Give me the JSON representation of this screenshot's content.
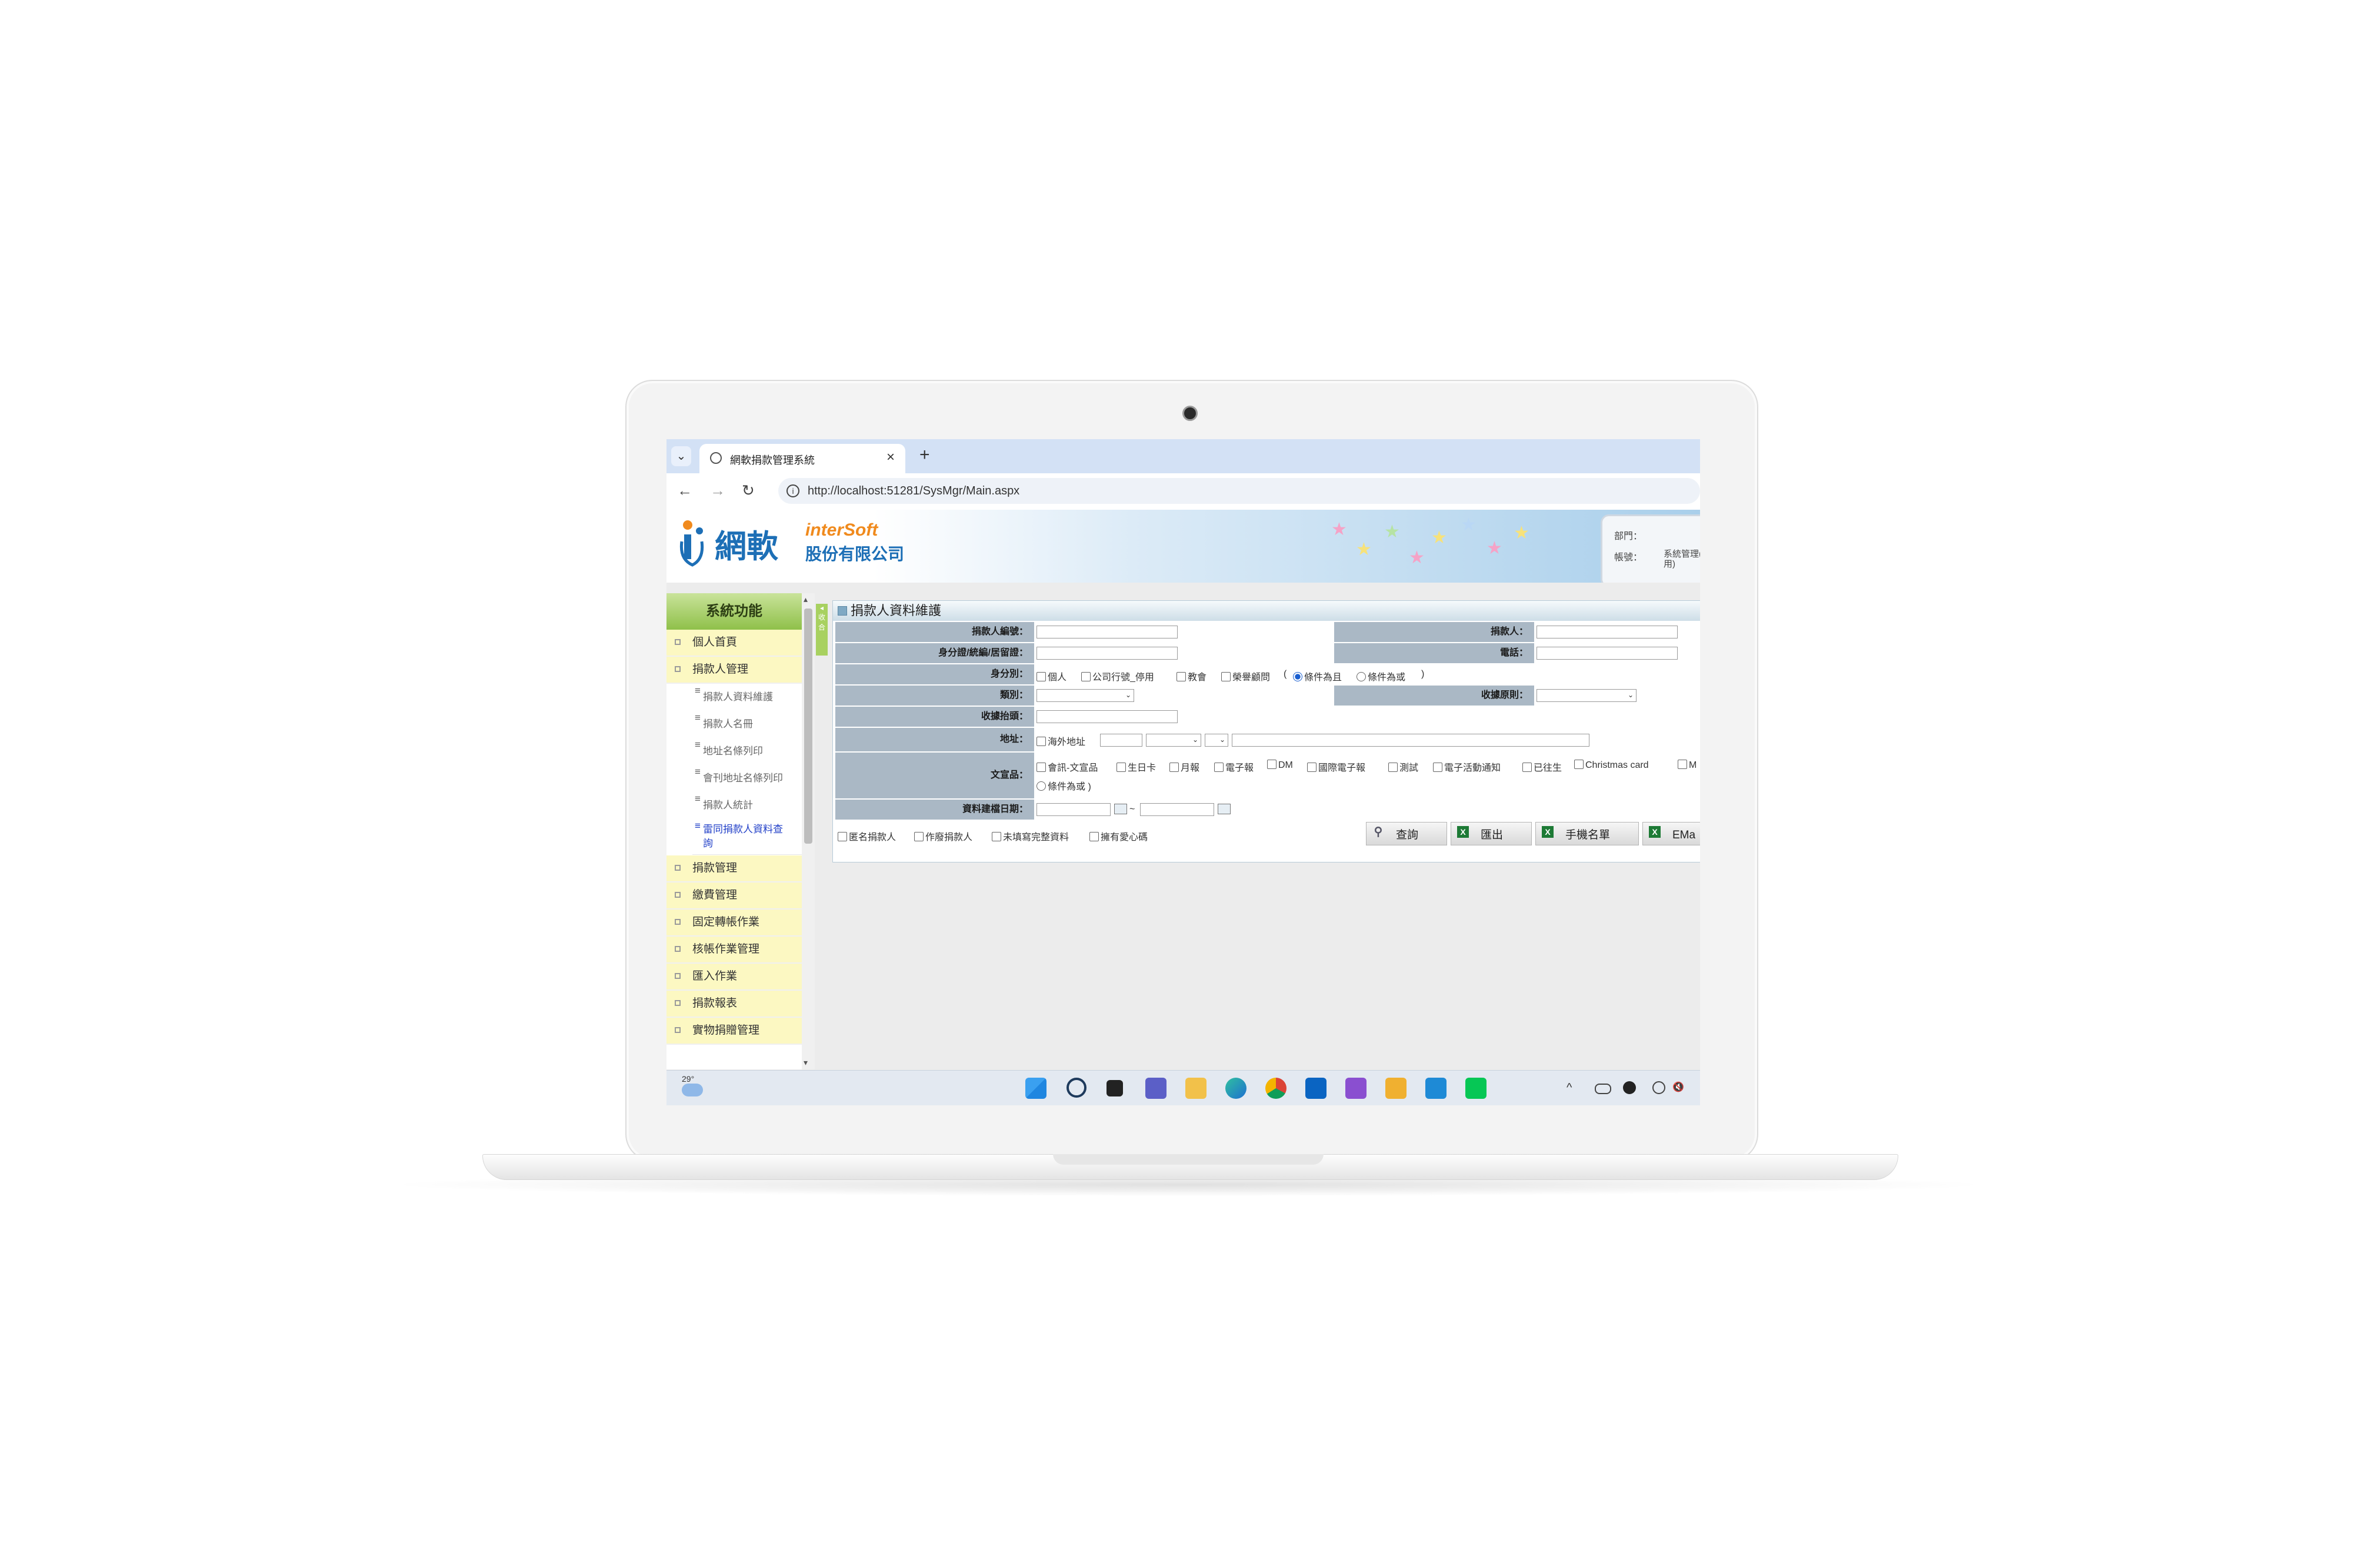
{
  "browser": {
    "tab_title": "網軟捐款管理系統",
    "url": "http://localhost:51281/SysMgr/Main.aspx",
    "new_tab": "+",
    "close": "×",
    "tab_menu": "⌄",
    "back": "←",
    "forward": "→",
    "reload": "↻",
    "info": "i"
  },
  "header": {
    "logo_cn": "網軟",
    "logo_en": "interSoft",
    "logo_company": "股份有限公司",
    "dept_label": "部門：",
    "account_label": "帳號：",
    "account_value": "系統管理(禁用)"
  },
  "sidebar": {
    "title": "系統功能",
    "items": [
      {
        "label": "個人首頁"
      },
      {
        "label": "捐款人管理"
      },
      {
        "label": "捐款管理"
      },
      {
        "label": "繳費管理"
      },
      {
        "label": "固定轉帳作業"
      },
      {
        "label": "核帳作業管理"
      },
      {
        "label": "匯入作業"
      },
      {
        "label": "捐款報表"
      },
      {
        "label": "實物捐贈管理"
      }
    ],
    "subitems": [
      {
        "label": "捐款人資料維護"
      },
      {
        "label": "捐款人名冊"
      },
      {
        "label": "地址名條列印"
      },
      {
        "label": "會刊地址名條列印"
      },
      {
        "label": "捐款人統計"
      },
      {
        "label": "雷同捐款人資料查詢"
      }
    ],
    "collapse_label": "◂ 收合"
  },
  "panel": {
    "title": "捐款人資料維護",
    "labels": {
      "donor_no": "捐款人編號：",
      "donor": "捐款人：",
      "id_no": "身分證/統編/居留證：",
      "phone": "電話：",
      "identity": "身分別：",
      "category": "類別：",
      "receipt_rule": "收據原則：",
      "receipt_title": "收據抬頭：",
      "address": "地址：",
      "publications": "文宣品：",
      "build_date": "資料建檔日期："
    },
    "identity_options": [
      "個人",
      "公司行號_停用",
      "教會",
      "榮譽顧問"
    ],
    "identity_radio_prefix": "(",
    "identity_radio": [
      "條件為且",
      "條件為或"
    ],
    "identity_radio_suffix": ")",
    "overseas_address": "海外地址",
    "publication_options": [
      "會訊-文宣品",
      "生日卡",
      "月報",
      "電子報",
      "DM",
      "國際電子報",
      "測試",
      "電子活動通知",
      "已往生",
      "Christmas card",
      "M"
    ],
    "publication_radio": "條件為或",
    "publication_radio_suffix": ")",
    "date_separator": "~",
    "flags": [
      "匿名捐款人",
      "作廢捐款人",
      "未填寫完整資料",
      "擁有愛心碼"
    ],
    "buttons": [
      {
        "label": "查詢",
        "icon": "magnifier-icon"
      },
      {
        "label": "匯出",
        "icon": "excel-icon"
      },
      {
        "label": "手機名單",
        "icon": "excel-icon"
      },
      {
        "label": "EMa",
        "icon": "excel-icon"
      }
    ]
  },
  "taskbar": {
    "temperature": "29°",
    "tray_up": "^",
    "tray_mute": "🔇"
  },
  "colors": {
    "sidebar_head": "#8fc04a",
    "menu_bg": "#fcf8c2",
    "label_bg": "#aab8c5",
    "brand_blue": "#1d6fb6",
    "brand_orange": "#f08a1d",
    "active_link": "#2240c8"
  }
}
